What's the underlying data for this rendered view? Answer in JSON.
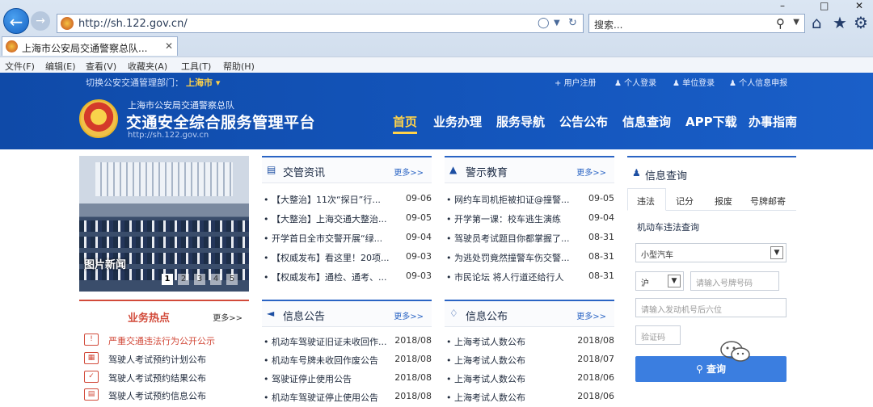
{
  "browser": {
    "address": "http://sh.122.gov.cn/",
    "search_placeholder": "搜索...",
    "tab_title": "上海市公安局交通警察总队...",
    "menu": [
      "文件(F)",
      "编辑(E)",
      "查看(V)",
      "收藏夹(A)",
      "工具(T)",
      "帮助(H)"
    ]
  },
  "site": {
    "switch_label": "切换公安交通管理部门：",
    "switch_city": "上海市",
    "top_links": [
      "用户注册",
      "个人登录",
      "单位登录",
      "个人信息申报"
    ],
    "org_name": "上海市公安局交通警察总队",
    "platform_name": "交通安全综合服务管理平台",
    "url": "http://sh.122.gov.cn",
    "nav": [
      "首页",
      "业务办理",
      "服务导航",
      "公告公布",
      "信息查询",
      "APP下载",
      "办事指南"
    ]
  },
  "banner": {
    "caption": "图片新闻",
    "pages": [
      "1",
      "2",
      "3",
      "4",
      "5"
    ]
  },
  "panels": {
    "news": {
      "title": "交管资讯",
      "more": "更多>>",
      "items": [
        {
          "title": "• 【大整治】11次“探日”行...",
          "date": "09-06"
        },
        {
          "title": "• 【大整治】上海交通大整治...",
          "date": "09-05"
        },
        {
          "title": "• 开学首日全市交警开展“绿...",
          "date": "09-04"
        },
        {
          "title": "• 【权威发布】看这里！20项...",
          "date": "09-03"
        },
        {
          "title": "• 【权威发布】通检、通考、...",
          "date": "09-03"
        }
      ]
    },
    "warning": {
      "title": "警示教育",
      "more": "更多>>",
      "items": [
        {
          "title": "• 网约车司机拒被扣证@撞警...",
          "date": "09-05"
        },
        {
          "title": "• 开学第一课：校车逃生演练",
          "date": "09-04"
        },
        {
          "title": "• 驾驶员考试题目你都掌握了...",
          "date": "08-31"
        },
        {
          "title": "• 为逃处罚竟然撞警车伤交警...",
          "date": "08-31"
        },
        {
          "title": "• 市民论坛 将人行道还给行人",
          "date": "08-31"
        }
      ]
    },
    "notice": {
      "title": "信息公告",
      "more": "更多>>",
      "items": [
        {
          "title": "• 机动车驾驶证旧证未收回作...",
          "date": "2018/08"
        },
        {
          "title": "• 机动车号牌未收回作废公告",
          "date": "2018/08"
        },
        {
          "title": "• 驾驶证停止使用公告",
          "date": "2018/08"
        },
        {
          "title": "• 机动车驾驶证停止使用公告",
          "date": "2018/08"
        }
      ]
    },
    "publish": {
      "title": "信息公布",
      "more": "更多>>",
      "items": [
        {
          "title": "• 上海考试人数公布",
          "date": "2018/08"
        },
        {
          "title": "• 上海考试人数公布",
          "date": "2018/07"
        },
        {
          "title": "• 上海考试人数公布",
          "date": "2018/06"
        },
        {
          "title": "• 上海考试人数公布",
          "date": "2018/06"
        }
      ]
    }
  },
  "hot": {
    "title": "业务热点",
    "more": "更多>>",
    "items": [
      {
        "text": "严重交通违法行为公开公示"
      },
      {
        "text": "驾驶人考试预约计划公布"
      },
      {
        "text": "驾驶人考试预约结果公布"
      },
      {
        "text": "驾驶人考试预约信息公布"
      }
    ]
  },
  "query": {
    "title": "信息查询",
    "tabs": [
      "违法",
      "记分",
      "报废",
      "号牌邮寄"
    ],
    "subtitle": "机动车违法查询",
    "vehicle_type": "小型汽车",
    "plate_prefix": "沪",
    "plate_placeholder": "请输入号牌号码",
    "engine_placeholder": "请输入发动机号后六位",
    "captcha_placeholder": "验证码",
    "button": "查询"
  }
}
